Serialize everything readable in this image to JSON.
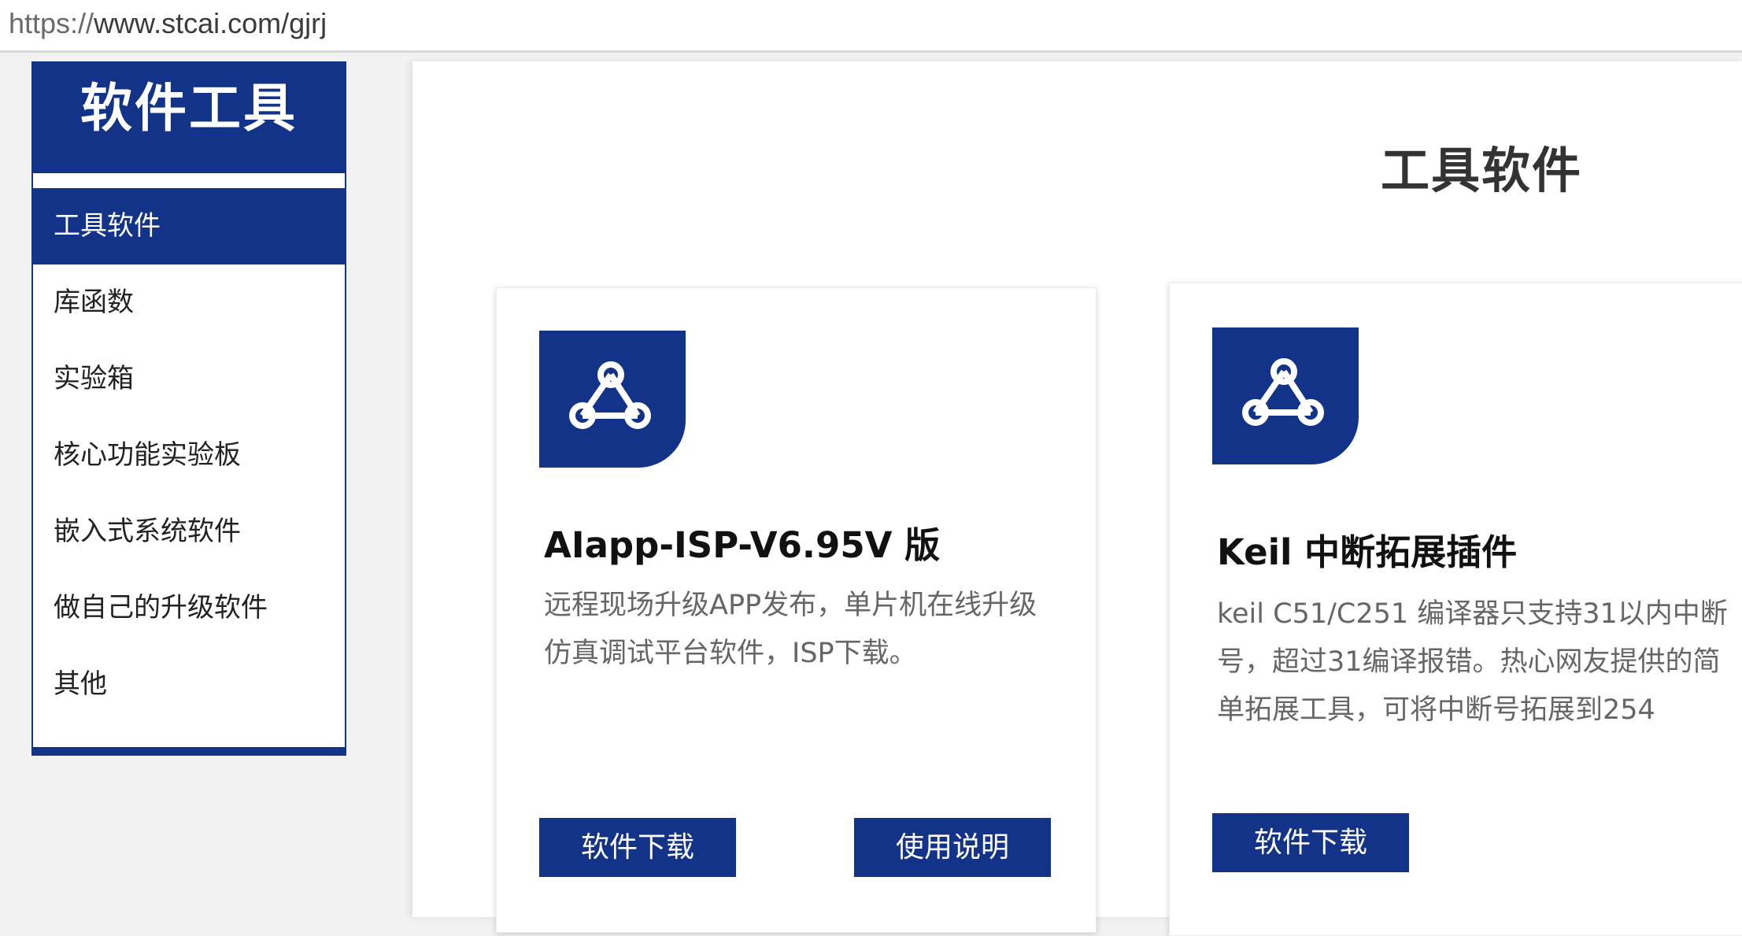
{
  "browser": {
    "url_scheme": "https://",
    "url_rest": "www.stcai.com/gjrj"
  },
  "sidebar": {
    "title": "软件工具",
    "items": [
      {
        "label": "工具软件",
        "active": true
      },
      {
        "label": "库函数",
        "active": false
      },
      {
        "label": "实验箱",
        "active": false
      },
      {
        "label": "核心功能实验板",
        "active": false
      },
      {
        "label": "嵌入式系统软件",
        "active": false
      },
      {
        "label": "做自己的升级软件",
        "active": false
      },
      {
        "label": "其他",
        "active": false
      }
    ]
  },
  "main": {
    "section_title": "工具软件",
    "cards": [
      {
        "icon": "share-network-icon",
        "title": "AIapp-ISP-V6.95V 版",
        "description": "远程现场升级APP发布，单片机在线升级\n仿真调试平台软件，ISP下载。",
        "buttons": [
          "软件下载",
          "使用说明"
        ]
      },
      {
        "icon": "share-network-icon",
        "title": "Keil 中断拓展插件",
        "description": "keil C51/C251 编译器只支持31以内中断\n号，超过31编译报错。热心网友提供的简\n单拓展工具，可将中断号拓展到254",
        "buttons": [
          "软件下载"
        ]
      }
    ]
  },
  "colors": {
    "brand_blue": "#123388",
    "page_background": "#f2f2f2",
    "text_dark": "#333333",
    "text_muted": "#666666"
  }
}
